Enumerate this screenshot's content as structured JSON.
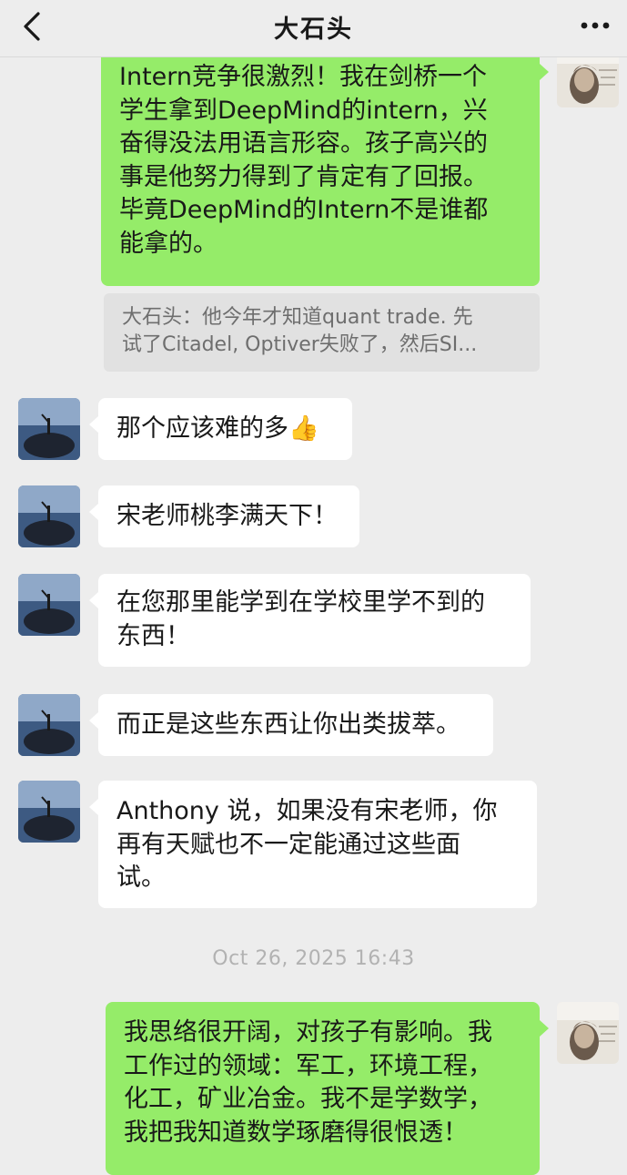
{
  "header": {
    "title": "大石头",
    "back_icon": "chevron-left-icon",
    "more_icon": "more-dots-icon"
  },
  "colors": {
    "background": "#ededed",
    "sent_bubble": "#95ec69",
    "received_bubble": "#ffffff",
    "quote_background": "#e1e1e1"
  },
  "messages": [
    {
      "side": "right",
      "text": "Intern竞争很激烈！我在剑桥一个\n学生拿到DeepMind的intern，兴\n奋得没法用语言形容。孩子高兴的\n事是他努力得到了肯定有了回报。\n毕竟DeepMind的Intern不是谁都\n能拿的。"
    },
    {
      "side": "right",
      "type": "quote",
      "text": "大石头：他今年才知道quant trade. 先\n试了Citadel, Optiver失败了，然后SI..."
    },
    {
      "side": "left",
      "text": "那个应该难的多👍"
    },
    {
      "side": "left",
      "text": "宋老师桃李满天下！"
    },
    {
      "side": "left",
      "text": "在您那里能学到在学校里学不到的\n东西！"
    },
    {
      "side": "left",
      "text": "而正是这些东西让你出类拔萃。"
    },
    {
      "side": "left",
      "text": "Anthony 说，如果没有宋老师，你\n再有天赋也不一定能通过这些面\n试。"
    },
    {
      "side": "right",
      "text": "我思络很开阔，对孩子有影响。我\n工作过的领域：军工，环境工程，\n化工，矿业冶金。我不是学数学，\n我把我知道数学琢磨得很恨透！"
    }
  ],
  "timestamp": "Oct 26, 2025 16:43"
}
